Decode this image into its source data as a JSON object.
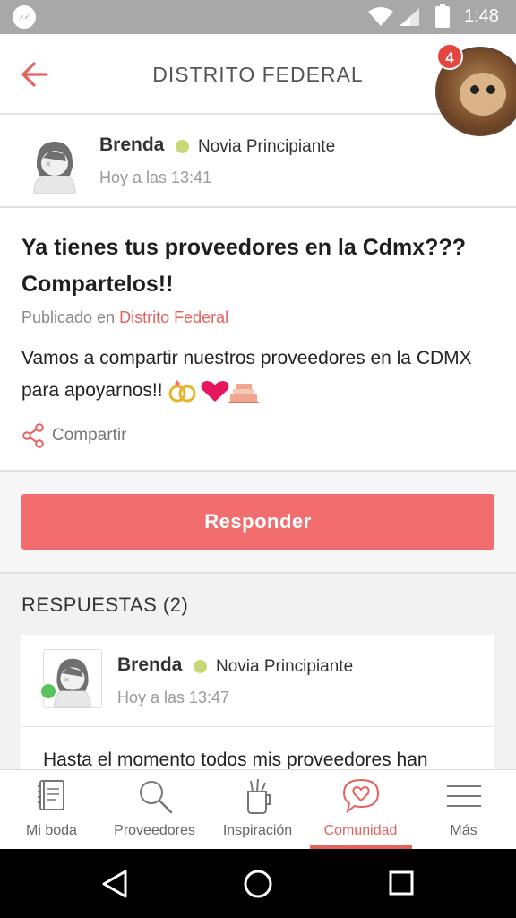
{
  "status_bar": {
    "time": "1:48"
  },
  "header": {
    "title": "DISTRITO FEDERAL",
    "notification_count": "4"
  },
  "post": {
    "author": {
      "name": "Brenda",
      "rank": "Novia Principiante",
      "time": "Hoy a las 13:41"
    },
    "title": "Ya tienes tus proveedores en la Cdmx??? Compartelos!!",
    "published_prefix": "Publicado en",
    "published_location": "Distrito Federal",
    "body": "Vamos a compartir nuestros proveedores en la CDMX para apoyarnos!!",
    "share_label": "Compartir"
  },
  "respond_label": "Responder",
  "replies": {
    "title": "RESPUESTAS (2)",
    "items": [
      {
        "name": "Brenda",
        "rank": "Novia Principiante",
        "time": "Hoy a las 13:47",
        "text": "Hasta el momento todos mis proveedores han"
      }
    ]
  },
  "bottom_nav": {
    "items": [
      {
        "label": "Mi boda",
        "icon": "book-icon"
      },
      {
        "label": "Proveedores",
        "icon": "search-icon"
      },
      {
        "label": "Inspiración",
        "icon": "pencil-cup-icon"
      },
      {
        "label": "Comunidad",
        "icon": "heart-chat-icon",
        "active": true
      },
      {
        "label": "Más",
        "icon": "menu-icon"
      }
    ]
  },
  "colors": {
    "accent": "#e5625f",
    "button": "#f26e6e",
    "rank_dot": "#c8d877",
    "online": "#57c25e"
  }
}
